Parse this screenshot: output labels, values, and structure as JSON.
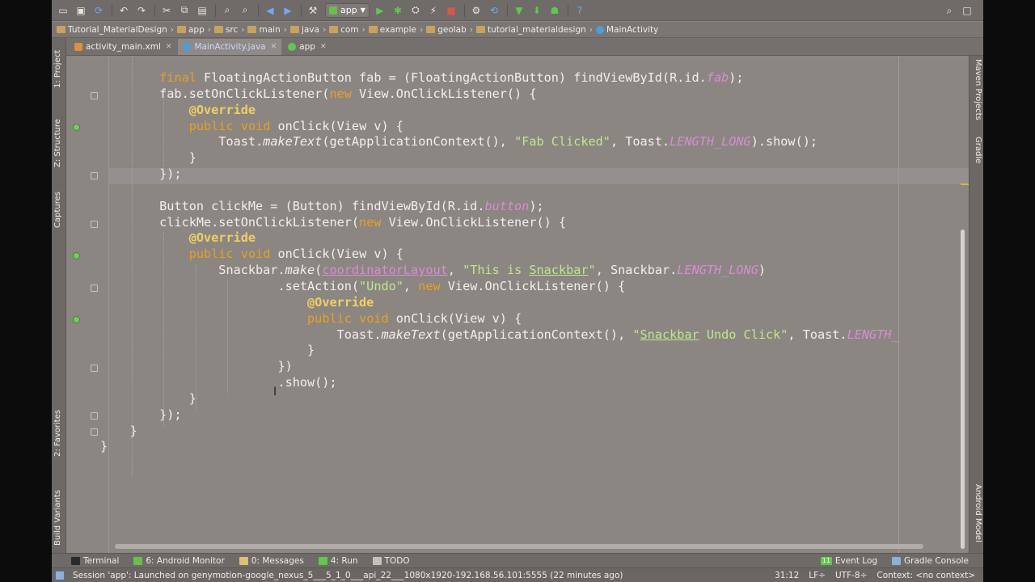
{
  "breadcrumbs": [
    "Tutorial_MaterialDesign",
    "app",
    "src",
    "main",
    "java",
    "com",
    "example",
    "geolab",
    "tutorial_materialdesign",
    "MainActivity"
  ],
  "tabs": [
    {
      "label": "activity_main.xml",
      "active": false
    },
    {
      "label": "MainActivity.java",
      "active": true
    },
    {
      "label": "app",
      "active": false
    }
  ],
  "toolbar": {
    "run_config": "app"
  },
  "left_panels": [
    "1: Project",
    "Z: Structure",
    "Captures",
    "2: Favorites",
    "Build Variants"
  ],
  "right_panels": [
    "Maven Projects",
    "Gradle",
    "Android Model"
  ],
  "bottom_tools": [
    {
      "label": "Terminal",
      "icon": "terminal-icon"
    },
    {
      "label": "6: Android Monitor",
      "icon": "android-icon"
    },
    {
      "label": "0: Messages",
      "icon": "messages-icon"
    },
    {
      "label": "4: Run",
      "icon": "run-icon"
    },
    {
      "label": "TODO",
      "icon": "todo-icon"
    }
  ],
  "bottom_tools_right": [
    {
      "label": "Event Log",
      "count": "11"
    },
    {
      "label": "Gradle Console"
    }
  ],
  "status": {
    "message": "Session 'app': Launched on genymotion-google_nexus_5___5_1_0___api_22___1080x1920-192.168.56.101:5555 (22 minutes ago)",
    "position": "31:12",
    "line_sep": "LF÷",
    "encoding": "UTF-8÷",
    "context": "Context: <no context>"
  },
  "code_lines": [
    "        final FloatingActionButton fab = (FloatingActionButton) findViewById(R.id.fab);",
    "        fab.setOnClickListener(new View.OnClickListener() {",
    "            @Override",
    "            public void onClick(View v) {",
    "                Toast.makeText(getApplicationContext(), \"Fab Clicked\", Toast.LENGTH_LONG).show();",
    "            }",
    "        });",
    "",
    "        Button clickMe = (Button) findViewById(R.id.button);",
    "        clickMe.setOnClickListener(new View.OnClickListener() {",
    "            @Override",
    "            public void onClick(View v) {",
    "                Snackbar.make(coordinatorLayout, \"This is Snackbar\", Snackbar.LENGTH_LONG)",
    "                        .setAction(\"Undo\", new View.OnClickListener() {",
    "                            @Override",
    "                            public void onClick(View v) {",
    "                                Toast.makeText(getApplicationContext(), \"Snackbar Undo Click\", Toast.LENGTH_",
    "                            }",
    "                        })",
    "                        .show();",
    "            }",
    "        });",
    "    }",
    "}"
  ]
}
